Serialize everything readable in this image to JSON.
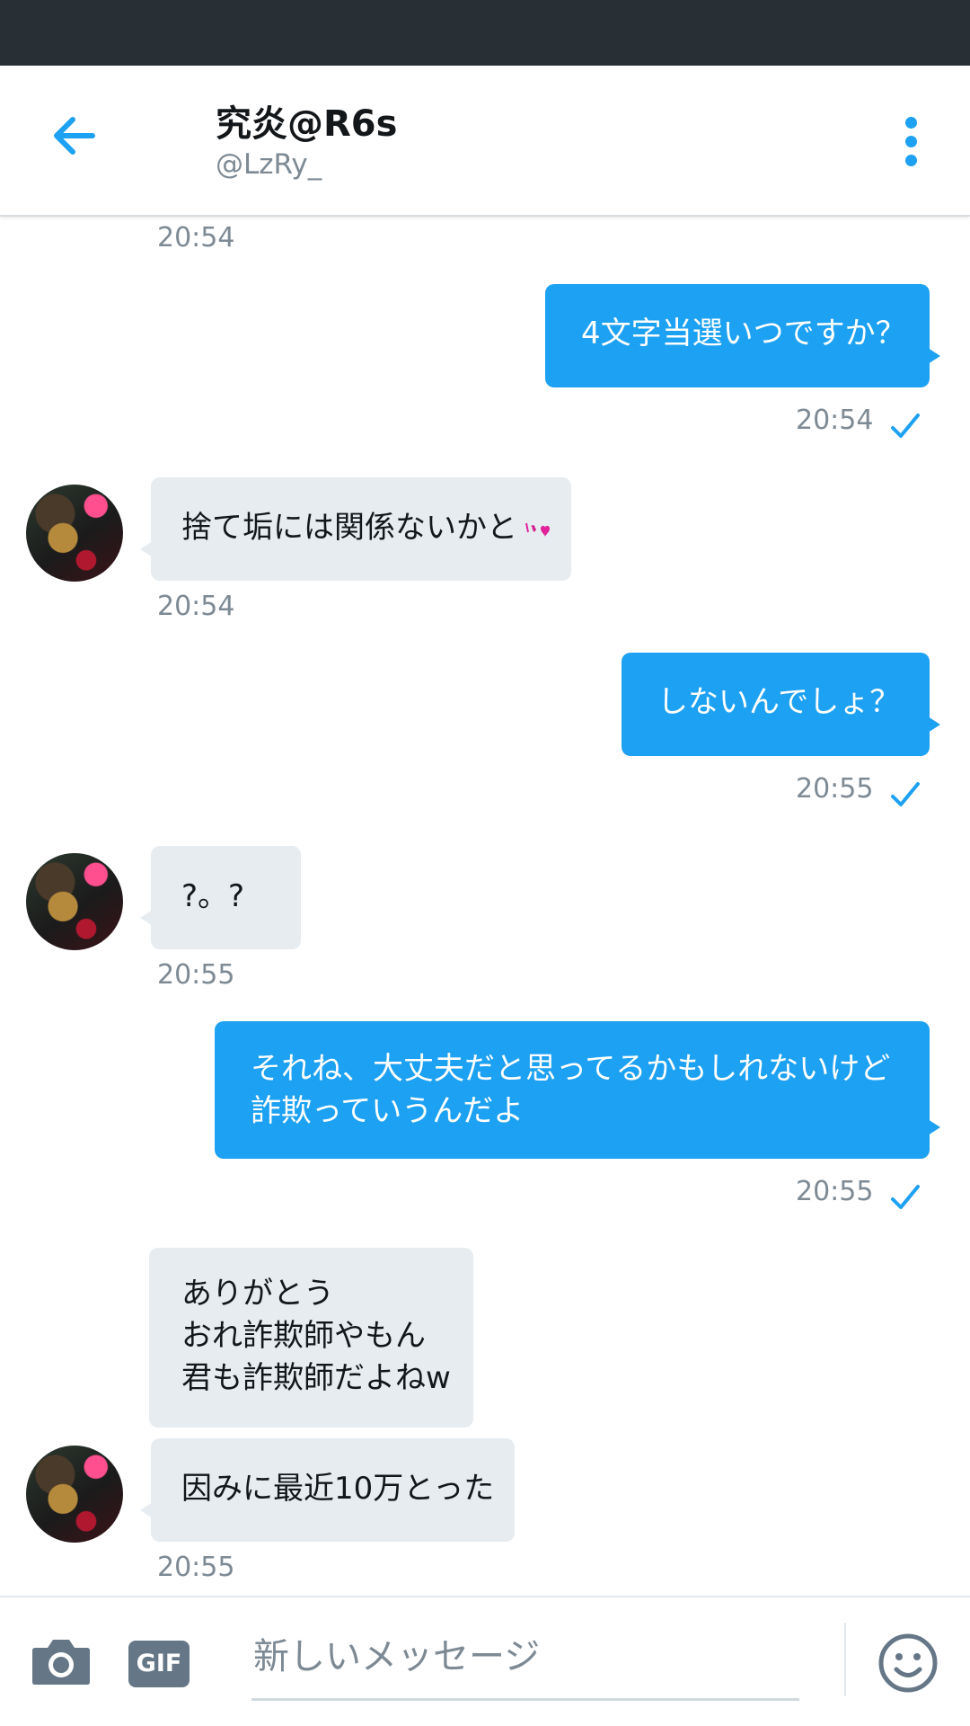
{
  "header": {
    "name": "究炎@R6s",
    "handle": "@LzRy_"
  },
  "messages": [
    {
      "id": "t0",
      "type": "timestamp",
      "text": "20:54"
    },
    {
      "id": "m1",
      "type": "sent",
      "text": "4文字当選いつですか？",
      "time": "20:54",
      "read": true
    },
    {
      "id": "m2",
      "type": "received",
      "text": "捨て垢には関係ないかと",
      "emoji": "heart-kiss-emoji",
      "time": "20:54"
    },
    {
      "id": "m3",
      "type": "sent",
      "text": "しないんでしょ？",
      "time": "20:55",
      "read": true
    },
    {
      "id": "m4",
      "type": "received",
      "text": "?。?",
      "time": "20:55"
    },
    {
      "id": "m5",
      "type": "sent",
      "lines": [
        "それね、大丈夫だと思ってるかもしれないけど",
        "詐欺っていうんだよ"
      ],
      "time": "20:55",
      "read": true
    },
    {
      "id": "m6",
      "type": "received",
      "lines": [
        "ありがとう",
        "おれ詐欺師やもん",
        "君も詐欺師だよねw"
      ]
    },
    {
      "id": "m7",
      "type": "received",
      "text": "因みに最近10万とった",
      "time": "20:55"
    }
  ],
  "composer": {
    "placeholder": "新しいメッセージ",
    "gif_label": "GIF"
  },
  "colors": {
    "accent": "#1da1f2",
    "received_bubble": "#e6ecf0",
    "status_bar": "#293035",
    "muted_text": "#7d8a94"
  },
  "icons": [
    "back-arrow-icon",
    "more-vertical-icon",
    "read-check-icon",
    "camera-icon",
    "gif-icon",
    "emoji-smiley-icon"
  ]
}
